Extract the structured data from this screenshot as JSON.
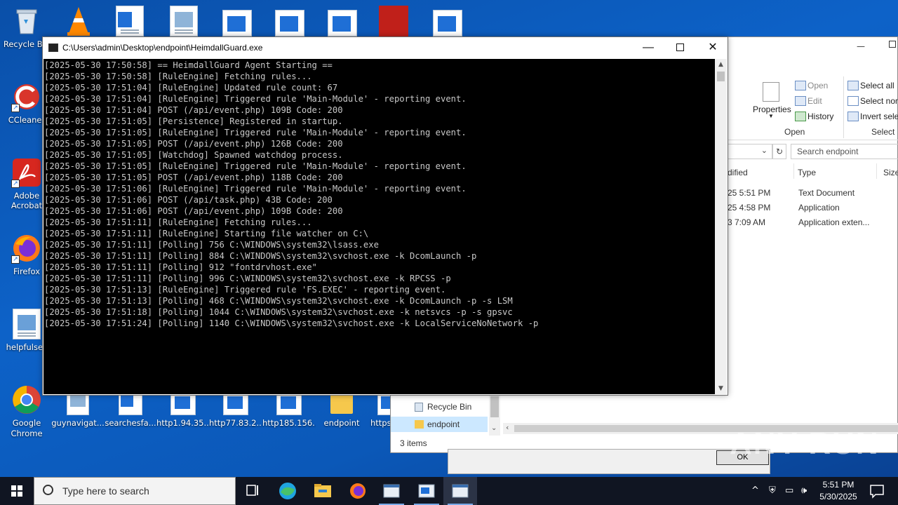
{
  "desktop": {
    "left_icons": [
      {
        "label": "Recycle Bin",
        "icon": "recycle-bin-icon"
      },
      {
        "label": "CCleaner",
        "icon": "ccleaner-icon"
      },
      {
        "label": "Adobe Acrobat",
        "icon": "acrobat-icon"
      },
      {
        "label": "Firefox",
        "icon": "firefox-icon"
      },
      {
        "label": "helpfulsec",
        "icon": "image-file-icon"
      },
      {
        "label": "Google Chrome",
        "icon": "chrome-icon"
      }
    ],
    "bottom_icons": [
      {
        "label": "guynavigat..."
      },
      {
        "label": "searchesfa..."
      },
      {
        "label": "http1.94.35...."
      },
      {
        "label": "http77.83.2..."
      },
      {
        "label": "http185.156...."
      },
      {
        "label": "endpoint"
      },
      {
        "label": "https"
      }
    ]
  },
  "console": {
    "title": "C:\\Users\\admin\\Desktop\\endpoint\\HeimdallGuard.exe",
    "lines": [
      "[2025-05-30 17:50:58] == HeimdallGuard Agent Starting ==",
      "[2025-05-30 17:50:58] [RuleEngine] Fetching rules...",
      "[2025-05-30 17:51:04] [RuleEngine] Updated rule count: 67",
      "[2025-05-30 17:51:04] [RuleEngine] Triggered rule 'Main-Module' - reporting event.",
      "[2025-05-30 17:51:04] POST (/api/event.php) 109B Code: 200",
      "[2025-05-30 17:51:05] [Persistence] Registered in startup.",
      "[2025-05-30 17:51:05] [RuleEngine] Triggered rule 'Main-Module' - reporting event.",
      "[2025-05-30 17:51:05] POST (/api/event.php) 126B Code: 200",
      "[2025-05-30 17:51:05] [Watchdog] Spawned watchdog process.",
      "[2025-05-30 17:51:05] [RuleEngine] Triggered rule 'Main-Module' - reporting event.",
      "[2025-05-30 17:51:05] POST (/api/event.php) 118B Code: 200",
      "[2025-05-30 17:51:06] [RuleEngine] Triggered rule 'Main-Module' - reporting event.",
      "[2025-05-30 17:51:06] POST (/api/task.php) 43B Code: 200",
      "[2025-05-30 17:51:06] POST (/api/event.php) 109B Code: 200",
      "[2025-05-30 17:51:11] [RuleEngine] Fetching rules...",
      "[2025-05-30 17:51:11] [RuleEngine] Starting file watcher on C:\\",
      "[2025-05-30 17:51:11] [Polling] 756 C:\\WINDOWS\\system32\\lsass.exe",
      "[2025-05-30 17:51:11] [Polling] 884 C:\\WINDOWS\\system32\\svchost.exe -k DcomLaunch -p",
      "[2025-05-30 17:51:11] [Polling] 912 \"fontdrvhost.exe\"",
      "[2025-05-30 17:51:11] [Polling] 996 C:\\WINDOWS\\system32\\svchost.exe -k RPCSS -p",
      "[2025-05-30 17:51:13] [RuleEngine] Triggered rule 'FS.EXEC' - reporting event.",
      "[2025-05-30 17:51:13] [Polling] 468 C:\\WINDOWS\\system32\\svchost.exe -k DcomLaunch -p -s LSM",
      "[2025-05-30 17:51:18] [Polling] 1044 C:\\WINDOWS\\system32\\svchost.exe -k netsvcs -p -s gpsvc",
      "[2025-05-30 17:51:24] [Polling] 1140 C:\\WINDOWS\\system32\\svchost.exe -k LocalServiceNoNetwork -p"
    ]
  },
  "explorer": {
    "ribbon": {
      "properties": "Properties",
      "open": "Open",
      "edit": "Edit",
      "history": "History",
      "open_group": "Open",
      "select_all": "Select all",
      "select_none": "Select non",
      "invert_selection": "Invert selec",
      "select_group": "Select"
    },
    "search_placeholder": "Search endpoint",
    "columns": {
      "modified": "dified",
      "type": "Type",
      "size": "Size"
    },
    "rows": [
      {
        "modified": "25 5:51 PM",
        "type": "Text Document"
      },
      {
        "modified": "25 4:58 PM",
        "type": "Application"
      },
      {
        "modified": "3 7:09 AM",
        "type": "Application exten..."
      }
    ],
    "nav": [
      {
        "label": "Recycle Bin"
      },
      {
        "label": "endpoint"
      }
    ],
    "status": "3 items"
  },
  "dialog": {
    "ok": "OK"
  },
  "taskbar": {
    "search_placeholder": "Type here to search",
    "time": "5:51 PM",
    "date": "5/30/2025"
  },
  "watermark": "ANY RUN"
}
